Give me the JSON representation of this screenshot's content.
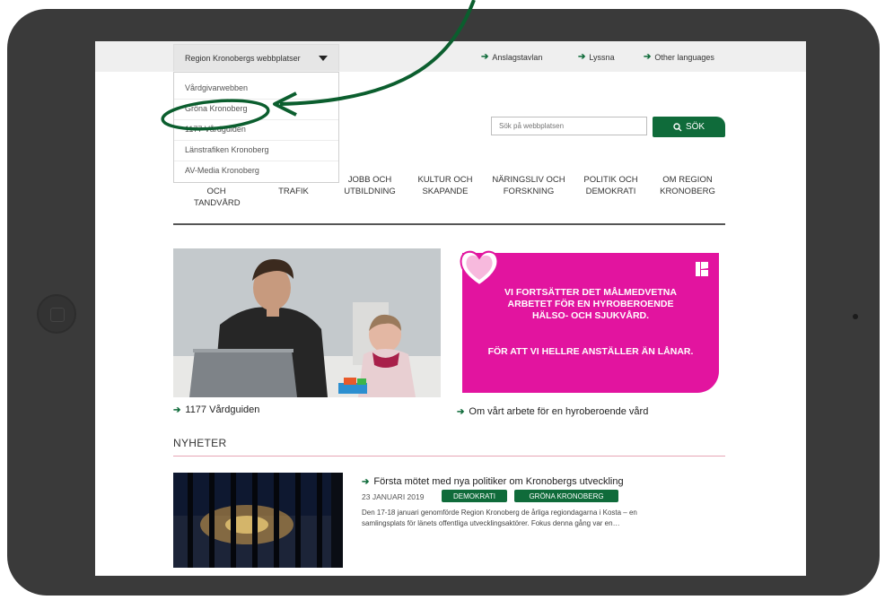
{
  "topbar": {
    "sites_label": "Region Kronobergs webbplatser",
    "links": [
      "Anslagstavlan",
      "Lyssna",
      "Other languages"
    ]
  },
  "sites_menu": {
    "items": [
      "Vårdgivarwebben",
      "Gröna Kronoberg",
      "1177 Vårdguiden",
      "Länstrafiken Kronoberg",
      "AV-Media Kronoberg"
    ]
  },
  "search": {
    "placeholder": "Sök på webbplatsen",
    "button_label": "SÖK"
  },
  "nav": {
    "items": [
      {
        "line1": "OCH",
        "line2": "TANDVÅRD"
      },
      {
        "line1": "",
        "line2": "TRAFIK"
      },
      {
        "line1": "JOBB OCH",
        "line2": "UTBILDNING"
      },
      {
        "line1": "KULTUR OCH",
        "line2": "SKAPANDE"
      },
      {
        "line1": "NÄRINGSLIV OCH",
        "line2": "FORSKNING"
      },
      {
        "line1": "POLITIK OCH",
        "line2": "DEMOKRATI"
      },
      {
        "line1": "OM REGION",
        "line2": "KRONOBERG"
      }
    ]
  },
  "promo": {
    "line1": "VI FORTSÄTTER DET MÅLMEDVETNA",
    "line2": "ARBETET FÖR EN HYROBEROENDE",
    "line3": "HÄLSO- OCH SJUKVÅRD.",
    "line4": "FÖR ATT VI HELLRE ANSTÄLLER ÄN LÅNAR.",
    "brand_color": "#e2149f"
  },
  "teasers": {
    "left_link": "1177 Vårdguiden",
    "right_link": "Om vårt arbete för en hyroberoende vård"
  },
  "news": {
    "section_title": "NYHETER",
    "title": "Första mötet med nya politiker om Kronobergs utveckling",
    "date": "23 JANUARI 2019",
    "tags": [
      "DEMOKRATI",
      "GRÖNA KRONOBERG"
    ],
    "body_line1": "Den 17-18 januari genomförde Region Kronoberg de årliga regiondagarna i Kosta – en",
    "body_line2": "samlingsplats för länets offentliga utvecklingsaktörer. Fokus denna gång var en…"
  },
  "colors": {
    "accent_green": "#0f6b3a",
    "annotation_green": "#0b5e2e"
  }
}
